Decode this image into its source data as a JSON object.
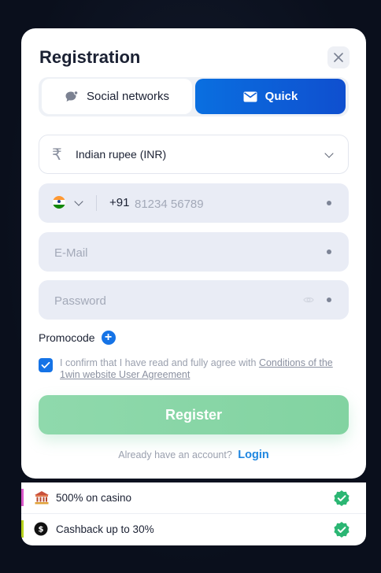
{
  "modal": {
    "title": "Registration",
    "tabs": [
      {
        "label": "Social networks",
        "icon": "chat-bubble-icon",
        "active": false
      },
      {
        "label": "Quick",
        "icon": "envelope-icon",
        "active": true
      }
    ]
  },
  "form": {
    "currency": {
      "icon": "rupee-icon",
      "value": "Indian rupee (INR)"
    },
    "phone": {
      "country_flag": "india-flag-icon",
      "code": "+91",
      "placeholder": "81234 56789"
    },
    "email": {
      "placeholder": "E-Mail"
    },
    "password": {
      "placeholder": "Password"
    },
    "promocode_label": "Promocode",
    "agreement": {
      "checked": true,
      "text": "I confirm that I have read and fully agree with",
      "link_text": "Conditions of the 1win website User Agreement"
    },
    "register_label": "Register",
    "login_prompt": "Already have an account?",
    "login_link": "Login"
  },
  "bonuses": [
    {
      "icon": "casino-building-icon",
      "text": "500% on casino",
      "accent": "#d957c9"
    },
    {
      "icon": "cashback-coin-icon",
      "text": "Cashback up to 30%",
      "accent": "#b7d21d"
    }
  ],
  "colors": {
    "accent_blue": "#1573e6",
    "register_green": "#8fd9ac",
    "verified_green": "#2bb673",
    "backdrop": "#0b1120"
  }
}
